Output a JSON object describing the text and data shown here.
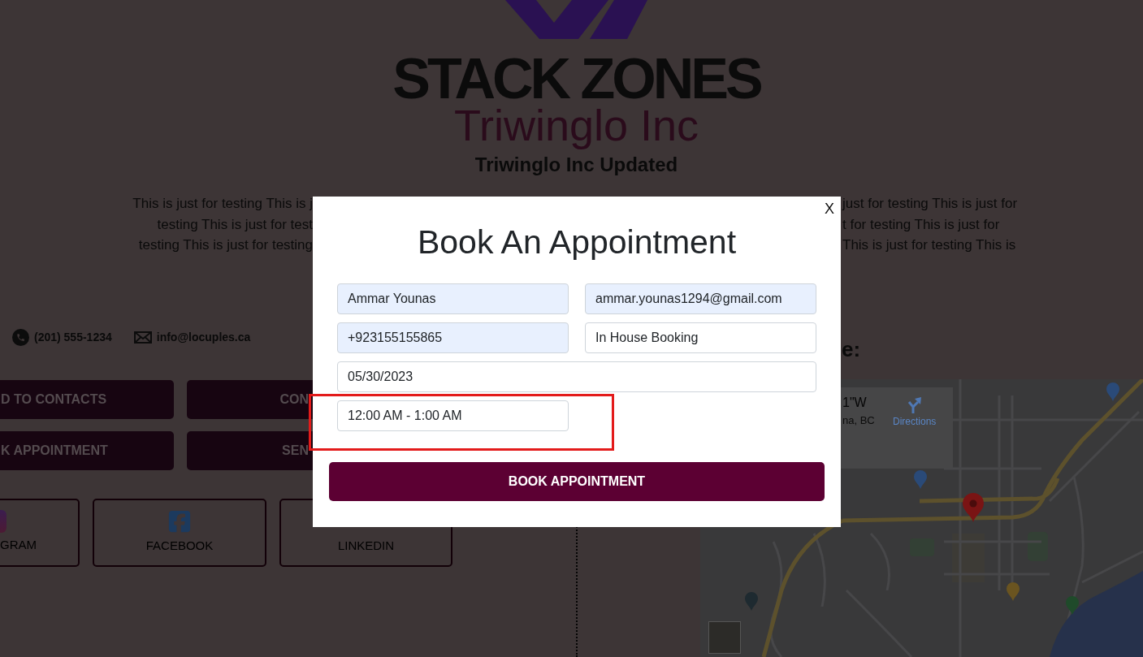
{
  "header": {
    "logo_text": "STACK ZONES",
    "company": "Triwinglo Inc",
    "subtitle": "Triwinglo Inc Updated"
  },
  "intro_lines": [
    {
      "left": "This is just for testing This is j",
      "right": "just for testing This is just for"
    },
    {
      "left": "testing This is just for test",
      "right": "t for testing This is just for"
    },
    {
      "left": "testing This is just for testing",
      "right": "This is just for testing This is"
    }
  ],
  "contacts": [
    {
      "kind": "phone",
      "text": "(201) 555-1234"
    },
    {
      "kind": "email",
      "text": "info@locuples.ca"
    }
  ],
  "action_buttons": [
    {
      "label": "D TO CONTACTS"
    },
    {
      "label": "CON"
    },
    {
      "label": "K APPOINTMENT"
    },
    {
      "label": "SEN"
    }
  ],
  "social_links": [
    {
      "kind": "instagram",
      "label": "GRAM"
    },
    {
      "kind": "facebook",
      "label": "FACEBOOK"
    },
    {
      "kind": "linkedin",
      "label": "LINKEDIN"
    }
  ],
  "location": {
    "heading": "e:",
    "place_card": {
      "coordinates": "1\"W",
      "address": "na, BC",
      "directions": "Directions"
    }
  },
  "modal": {
    "close": "X",
    "title": "Book An Appointment",
    "fields": [
      {
        "kind": "name",
        "value": "Ammar Younas",
        "autofilled": true
      },
      {
        "kind": "email",
        "value": "ammar.younas1294@gmail.com",
        "autofilled": true
      },
      {
        "kind": "phone",
        "value": "+923155155865",
        "autofilled": true
      },
      {
        "kind": "booking_type",
        "value": "In House Booking",
        "autofilled": false
      },
      {
        "kind": "date",
        "value": "05/30/2023",
        "autofilled": false
      },
      {
        "kind": "time",
        "value": "12:00 AM - 1:00 AM",
        "autofilled": false
      }
    ],
    "submit": "BOOK APPOINTMENT",
    "annotation": {
      "kind": "rectangle"
    }
  }
}
